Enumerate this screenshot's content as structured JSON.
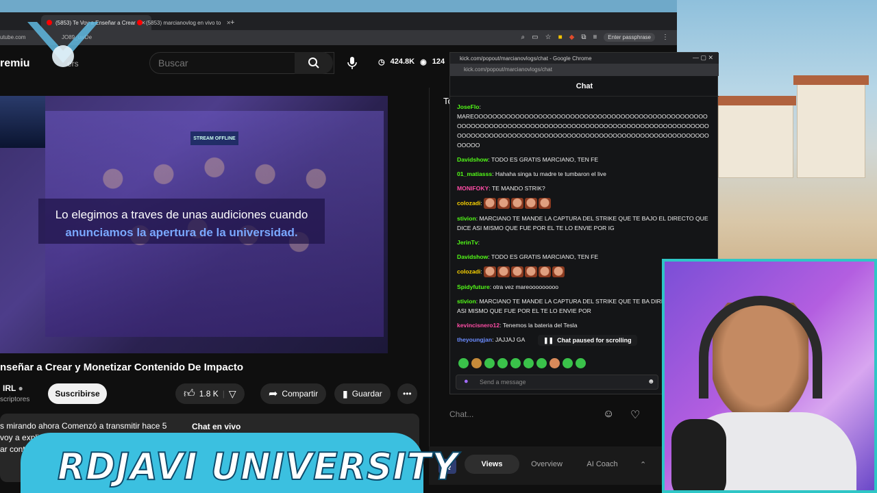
{
  "browser": {
    "tabs": [
      {
        "label": "(5853) Te Voy a Enseñar a Crear",
        "active": true
      },
      {
        "label": "(5853) marcianovlog en vivo to",
        "active": false
      }
    ],
    "address_partial": "utube.com",
    "address_fragment": "JO89_uwDe",
    "passphrase_label": "Enter passphrase"
  },
  "yt_header": {
    "logo_text": "remiu",
    "logo_sub": "ers",
    "search_placeholder": "Buscar",
    "views": "424.8K",
    "watching": "124"
  },
  "video": {
    "banner_offline": "STREAM OFFLINE",
    "caption_line1": "Lo elegimos a traves de unas audiciones cuando",
    "caption_line2": "anunciamos la apertura de la universidad.",
    "title": "nseñar a Crear y Monetizar Contenido De Impacto",
    "channel": "IRL",
    "subs_label": "scriptores",
    "subscribe_label": "Suscribirse",
    "likes": "1.8 K",
    "share_label": "Compartir",
    "save_label": "Guardar",
    "desc_line1": "s mirando ahora  Comenzó a transmitir hace 5",
    "desc_line2": "voy a explicart",
    "desc_line3": "ar conten",
    "live_chat_label": "Chat en vivo"
  },
  "yt_chat": {
    "input_placeholder": "Chat...",
    "tabs": [
      "Views",
      "Overview",
      "AI Coach"
    ],
    "tab_header_partial": "To"
  },
  "kick": {
    "window_title": "kick.com/popout/marcianovlogs/chat - Google Chrome",
    "url": "kick.com/popout/marcianovlogs/chat",
    "header": "Chat",
    "messages": [
      {
        "user": "JoseFlo",
        "color": "#53fc18",
        "text": "MAREOOOOOOOOOOOOOOOOOOOOOOOOOOOOOOOOOOOOOOOOOOOOOOOOOOOOOOOOOOOOOOOOOOOOOOOOOOOOOOOOOOOOOOOOOOOOOOOOOOOOOOOOOOOOOOOOOOOOOOOOOOOOOOOOOOOOOOOOOOOOOOOOOOOOOOOOOOOOOOOOOOOOOO"
      },
      {
        "user": "Davidshow",
        "color": "#53fc18",
        "text": "TODO ES GRATIS MARCIANO, TEN FE"
      },
      {
        "user": "01_matiasss",
        "color": "#53fc18",
        "text": "Hahaha singa tu madre te tumbaron el live"
      },
      {
        "user": "MONIFOKY",
        "color": "#ff4da6",
        "text": "TE MANDO STRIK?"
      },
      {
        "user": "colozadi",
        "color": "#ffd700",
        "text": ""
      },
      {
        "user": "stivion",
        "color": "#53fc18",
        "text": "MARCIANO TE MANDE LA CAPTURA DEL STRIKE QUE TE BAJO EL DIRECTO QUE DICE ASI MISMO QUE FUE POR EL TE LO ENVIE POR IG"
      },
      {
        "user": "JerinTv",
        "color": "#53fc18",
        "text": ""
      },
      {
        "user": "Davidshow",
        "color": "#53fc18",
        "text": "TODO ES GRATIS MARCIANO, TEN FE"
      },
      {
        "user": "colozadi",
        "color": "#ffd700",
        "text": ""
      },
      {
        "user": "Spidyfuture",
        "color": "#53fc18",
        "text": "otra vez mareooooooooo"
      },
      {
        "user": "stivion",
        "color": "#53fc18",
        "text": "MARCIANO TE MANDE LA CAPTURA DEL STRIKE QUE TE BA DIRECTO QUE DICE ASI MISMO QUE FUE POR EL TE LO ENVIE POR"
      },
      {
        "user": "kevincisnero12",
        "color": "#ff4da6",
        "text": "Tenemos la bateria del Tesla"
      },
      {
        "user": "theyoungjan",
        "color": "#6b8cff",
        "text": "JAJJAJ GA"
      }
    ],
    "paused_label": "Chat paused for scrolling",
    "input_placeholder": "Send a message"
  },
  "overlay": {
    "banner_text": "RDJAVI UNIVERSITY"
  },
  "colors": {
    "kick_green": "#53fc18",
    "banner_cyan": "#3bc0e0",
    "webcam_border": "#2ec6c6"
  }
}
